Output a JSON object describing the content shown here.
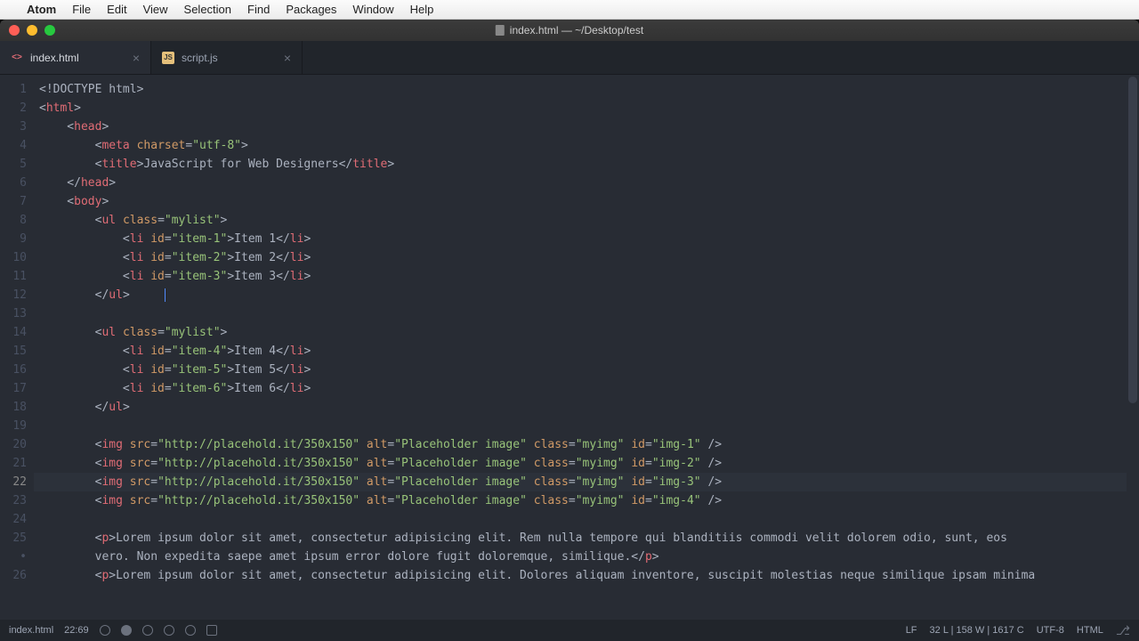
{
  "menubar": {
    "app": "Atom",
    "items": [
      "File",
      "Edit",
      "View",
      "Selection",
      "Find",
      "Packages",
      "Window",
      "Help"
    ]
  },
  "window": {
    "title": "index.html — ~/Desktop/test"
  },
  "tabs": [
    {
      "label": "index.html",
      "type": "html",
      "active": true
    },
    {
      "label": "script.js",
      "type": "js",
      "active": false
    }
  ],
  "gutter": [
    "1",
    "2",
    "3",
    "4",
    "5",
    "6",
    "7",
    "8",
    "9",
    "10",
    "11",
    "12",
    "13",
    "14",
    "15",
    "16",
    "17",
    "18",
    "19",
    "20",
    "21",
    "22",
    "23",
    "24",
    "25",
    "•",
    "26"
  ],
  "active_line": 22,
  "code_lines": [
    [
      {
        "c": "c-pun",
        "t": "<!"
      },
      {
        "c": "c-doctype",
        "t": "DOCTYPE html"
      },
      {
        "c": "c-pun",
        "t": ">"
      }
    ],
    [
      {
        "c": "c-pun",
        "t": "<"
      },
      {
        "c": "c-tag",
        "t": "html"
      },
      {
        "c": "c-pun",
        "t": ">"
      }
    ],
    [
      {
        "c": "c-pun",
        "t": "    <"
      },
      {
        "c": "c-tag",
        "t": "head"
      },
      {
        "c": "c-pun",
        "t": ">"
      }
    ],
    [
      {
        "c": "c-pun",
        "t": "        <"
      },
      {
        "c": "c-tag",
        "t": "meta"
      },
      {
        "c": "c-pun",
        "t": " "
      },
      {
        "c": "c-attr",
        "t": "charset"
      },
      {
        "c": "c-pun",
        "t": "="
      },
      {
        "c": "c-str",
        "t": "\"utf-8\""
      },
      {
        "c": "c-pun",
        "t": ">"
      }
    ],
    [
      {
        "c": "c-pun",
        "t": "        <"
      },
      {
        "c": "c-tag",
        "t": "title"
      },
      {
        "c": "c-pun",
        "t": ">"
      },
      {
        "c": "c-txt",
        "t": "JavaScript for Web Designers"
      },
      {
        "c": "c-pun",
        "t": "</"
      },
      {
        "c": "c-tag",
        "t": "title"
      },
      {
        "c": "c-pun",
        "t": ">"
      }
    ],
    [
      {
        "c": "c-pun",
        "t": "    </"
      },
      {
        "c": "c-tag",
        "t": "head"
      },
      {
        "c": "c-pun",
        "t": ">"
      }
    ],
    [
      {
        "c": "c-pun",
        "t": "    <"
      },
      {
        "c": "c-tag",
        "t": "body"
      },
      {
        "c": "c-pun",
        "t": ">"
      }
    ],
    [
      {
        "c": "c-pun",
        "t": "        <"
      },
      {
        "c": "c-tag",
        "t": "ul"
      },
      {
        "c": "c-pun",
        "t": " "
      },
      {
        "c": "c-attr",
        "t": "class"
      },
      {
        "c": "c-pun",
        "t": "="
      },
      {
        "c": "c-str",
        "t": "\"mylist\""
      },
      {
        "c": "c-pun",
        "t": ">"
      }
    ],
    [
      {
        "c": "c-pun",
        "t": "            <"
      },
      {
        "c": "c-tag",
        "t": "li"
      },
      {
        "c": "c-pun",
        "t": " "
      },
      {
        "c": "c-attr",
        "t": "id"
      },
      {
        "c": "c-pun",
        "t": "="
      },
      {
        "c": "c-str",
        "t": "\"item-1\""
      },
      {
        "c": "c-pun",
        "t": ">"
      },
      {
        "c": "c-txt",
        "t": "Item 1"
      },
      {
        "c": "c-pun",
        "t": "</"
      },
      {
        "c": "c-tag",
        "t": "li"
      },
      {
        "c": "c-pun",
        "t": ">"
      }
    ],
    [
      {
        "c": "c-pun",
        "t": "            <"
      },
      {
        "c": "c-tag",
        "t": "li"
      },
      {
        "c": "c-pun",
        "t": " "
      },
      {
        "c": "c-attr",
        "t": "id"
      },
      {
        "c": "c-pun",
        "t": "="
      },
      {
        "c": "c-str",
        "t": "\"item-2\""
      },
      {
        "c": "c-pun",
        "t": ">"
      },
      {
        "c": "c-txt",
        "t": "Item 2"
      },
      {
        "c": "c-pun",
        "t": "</"
      },
      {
        "c": "c-tag",
        "t": "li"
      },
      {
        "c": "c-pun",
        "t": ">"
      }
    ],
    [
      {
        "c": "c-pun",
        "t": "            <"
      },
      {
        "c": "c-tag",
        "t": "li"
      },
      {
        "c": "c-pun",
        "t": " "
      },
      {
        "c": "c-attr",
        "t": "id"
      },
      {
        "c": "c-pun",
        "t": "="
      },
      {
        "c": "c-str",
        "t": "\"item-3\""
      },
      {
        "c": "c-pun",
        "t": ">"
      },
      {
        "c": "c-txt",
        "t": "Item 3"
      },
      {
        "c": "c-pun",
        "t": "</"
      },
      {
        "c": "c-tag",
        "t": "li"
      },
      {
        "c": "c-pun",
        "t": ">"
      }
    ],
    [
      {
        "c": "c-pun",
        "t": "        </"
      },
      {
        "c": "c-tag",
        "t": "ul"
      },
      {
        "c": "c-pun",
        "t": ">"
      },
      {
        "c": "c-txt",
        "t": "     "
      },
      {
        "c": "cursor",
        "t": ""
      }
    ],
    [],
    [
      {
        "c": "c-pun",
        "t": "        <"
      },
      {
        "c": "c-tag",
        "t": "ul"
      },
      {
        "c": "c-pun",
        "t": " "
      },
      {
        "c": "c-attr",
        "t": "class"
      },
      {
        "c": "c-pun",
        "t": "="
      },
      {
        "c": "c-str",
        "t": "\"mylist\""
      },
      {
        "c": "c-pun",
        "t": ">"
      }
    ],
    [
      {
        "c": "c-pun",
        "t": "            <"
      },
      {
        "c": "c-tag",
        "t": "li"
      },
      {
        "c": "c-pun",
        "t": " "
      },
      {
        "c": "c-attr",
        "t": "id"
      },
      {
        "c": "c-pun",
        "t": "="
      },
      {
        "c": "c-str",
        "t": "\"item-4\""
      },
      {
        "c": "c-pun",
        "t": ">"
      },
      {
        "c": "c-txt",
        "t": "Item 4"
      },
      {
        "c": "c-pun",
        "t": "</"
      },
      {
        "c": "c-tag",
        "t": "li"
      },
      {
        "c": "c-pun",
        "t": ">"
      }
    ],
    [
      {
        "c": "c-pun",
        "t": "            <"
      },
      {
        "c": "c-tag",
        "t": "li"
      },
      {
        "c": "c-pun",
        "t": " "
      },
      {
        "c": "c-attr",
        "t": "id"
      },
      {
        "c": "c-pun",
        "t": "="
      },
      {
        "c": "c-str",
        "t": "\"item-5\""
      },
      {
        "c": "c-pun",
        "t": ">"
      },
      {
        "c": "c-txt",
        "t": "Item 5"
      },
      {
        "c": "c-pun",
        "t": "</"
      },
      {
        "c": "c-tag",
        "t": "li"
      },
      {
        "c": "c-pun",
        "t": ">"
      }
    ],
    [
      {
        "c": "c-pun",
        "t": "            <"
      },
      {
        "c": "c-tag",
        "t": "li"
      },
      {
        "c": "c-pun",
        "t": " "
      },
      {
        "c": "c-attr",
        "t": "id"
      },
      {
        "c": "c-pun",
        "t": "="
      },
      {
        "c": "c-str",
        "t": "\"item-6\""
      },
      {
        "c": "c-pun",
        "t": ">"
      },
      {
        "c": "c-txt",
        "t": "Item 6"
      },
      {
        "c": "c-pun",
        "t": "</"
      },
      {
        "c": "c-tag",
        "t": "li"
      },
      {
        "c": "c-pun",
        "t": ">"
      }
    ],
    [
      {
        "c": "c-pun",
        "t": "        </"
      },
      {
        "c": "c-tag",
        "t": "ul"
      },
      {
        "c": "c-pun",
        "t": ">"
      }
    ],
    [],
    [
      {
        "c": "c-pun",
        "t": "        <"
      },
      {
        "c": "c-tag",
        "t": "img"
      },
      {
        "c": "c-pun",
        "t": " "
      },
      {
        "c": "c-attr",
        "t": "src"
      },
      {
        "c": "c-pun",
        "t": "="
      },
      {
        "c": "c-str",
        "t": "\"http://placehold.it/350x150\""
      },
      {
        "c": "c-pun",
        "t": " "
      },
      {
        "c": "c-attr",
        "t": "alt"
      },
      {
        "c": "c-pun",
        "t": "="
      },
      {
        "c": "c-str",
        "t": "\"Placeholder image\""
      },
      {
        "c": "c-pun",
        "t": " "
      },
      {
        "c": "c-attr",
        "t": "class"
      },
      {
        "c": "c-pun",
        "t": "="
      },
      {
        "c": "c-str",
        "t": "\"myimg\""
      },
      {
        "c": "c-pun",
        "t": " "
      },
      {
        "c": "c-attr",
        "t": "id"
      },
      {
        "c": "c-pun",
        "t": "="
      },
      {
        "c": "c-str",
        "t": "\"img-1\""
      },
      {
        "c": "c-pun",
        "t": " />"
      }
    ],
    [
      {
        "c": "c-pun",
        "t": "        <"
      },
      {
        "c": "c-tag",
        "t": "img"
      },
      {
        "c": "c-pun",
        "t": " "
      },
      {
        "c": "c-attr",
        "t": "src"
      },
      {
        "c": "c-pun",
        "t": "="
      },
      {
        "c": "c-str",
        "t": "\"http://placehold.it/350x150\""
      },
      {
        "c": "c-pun",
        "t": " "
      },
      {
        "c": "c-attr",
        "t": "alt"
      },
      {
        "c": "c-pun",
        "t": "="
      },
      {
        "c": "c-str",
        "t": "\"Placeholder image\""
      },
      {
        "c": "c-pun",
        "t": " "
      },
      {
        "c": "c-attr",
        "t": "class"
      },
      {
        "c": "c-pun",
        "t": "="
      },
      {
        "c": "c-str",
        "t": "\"myimg\""
      },
      {
        "c": "c-pun",
        "t": " "
      },
      {
        "c": "c-attr",
        "t": "id"
      },
      {
        "c": "c-pun",
        "t": "="
      },
      {
        "c": "c-str",
        "t": "\"img-2\""
      },
      {
        "c": "c-pun",
        "t": " />"
      }
    ],
    [
      {
        "c": "c-pun",
        "t": "        <"
      },
      {
        "c": "c-tag",
        "t": "img"
      },
      {
        "c": "c-pun",
        "t": " "
      },
      {
        "c": "c-attr",
        "t": "src"
      },
      {
        "c": "c-pun",
        "t": "="
      },
      {
        "c": "c-str",
        "t": "\"http://placehold.it/350x150\""
      },
      {
        "c": "c-pun",
        "t": " "
      },
      {
        "c": "c-attr",
        "t": "alt"
      },
      {
        "c": "c-pun",
        "t": "="
      },
      {
        "c": "c-str",
        "t": "\"Placeholder image\""
      },
      {
        "c": "c-pun",
        "t": " "
      },
      {
        "c": "c-attr",
        "t": "class"
      },
      {
        "c": "c-pun",
        "t": "="
      },
      {
        "c": "c-str",
        "t": "\"myimg\""
      },
      {
        "c": "c-pun",
        "t": " "
      },
      {
        "c": "c-attr",
        "t": "id"
      },
      {
        "c": "c-pun",
        "t": "="
      },
      {
        "c": "c-str",
        "t": "\"img-3\""
      },
      {
        "c": "c-pun",
        "t": " />"
      }
    ],
    [
      {
        "c": "c-pun",
        "t": "        <"
      },
      {
        "c": "c-tag",
        "t": "img"
      },
      {
        "c": "c-pun",
        "t": " "
      },
      {
        "c": "c-attr",
        "t": "src"
      },
      {
        "c": "c-pun",
        "t": "="
      },
      {
        "c": "c-str",
        "t": "\"http://placehold.it/350x150\""
      },
      {
        "c": "c-pun",
        "t": " "
      },
      {
        "c": "c-attr",
        "t": "alt"
      },
      {
        "c": "c-pun",
        "t": "="
      },
      {
        "c": "c-str",
        "t": "\"Placeholder image\""
      },
      {
        "c": "c-pun",
        "t": " "
      },
      {
        "c": "c-attr",
        "t": "class"
      },
      {
        "c": "c-pun",
        "t": "="
      },
      {
        "c": "c-str",
        "t": "\"myimg\""
      },
      {
        "c": "c-pun",
        "t": " "
      },
      {
        "c": "c-attr",
        "t": "id"
      },
      {
        "c": "c-pun",
        "t": "="
      },
      {
        "c": "c-str",
        "t": "\"img-4\""
      },
      {
        "c": "c-pun",
        "t": " />"
      }
    ],
    [],
    [
      {
        "c": "c-pun",
        "t": "        <"
      },
      {
        "c": "c-tag",
        "t": "p"
      },
      {
        "c": "c-pun",
        "t": ">"
      },
      {
        "c": "c-txt",
        "t": "Lorem ipsum dolor sit amet, consectetur adipisicing elit. Rem nulla tempore qui blanditiis commodi velit dolorem odio, sunt, eos"
      }
    ],
    [
      {
        "c": "c-txt",
        "t": "        vero. Non expedita saepe amet ipsum error dolore fugit doloremque, similique."
      },
      {
        "c": "c-pun",
        "t": "</"
      },
      {
        "c": "c-tag",
        "t": "p"
      },
      {
        "c": "c-pun",
        "t": ">"
      }
    ],
    [
      {
        "c": "c-pun",
        "t": "        <"
      },
      {
        "c": "c-tag",
        "t": "p"
      },
      {
        "c": "c-pun",
        "t": ">"
      },
      {
        "c": "c-txt",
        "t": "Lorem ipsum dolor sit amet, consectetur adipisicing elit. Dolores aliquam inventore, suscipit molestias neque similique ipsam minima"
      }
    ]
  ],
  "statusbar": {
    "file": "index.html",
    "cursor": "22:69",
    "line_ending": "LF",
    "stats": "32 L | 158 W | 1617 C",
    "encoding": "UTF-8",
    "grammar": "HTML"
  }
}
